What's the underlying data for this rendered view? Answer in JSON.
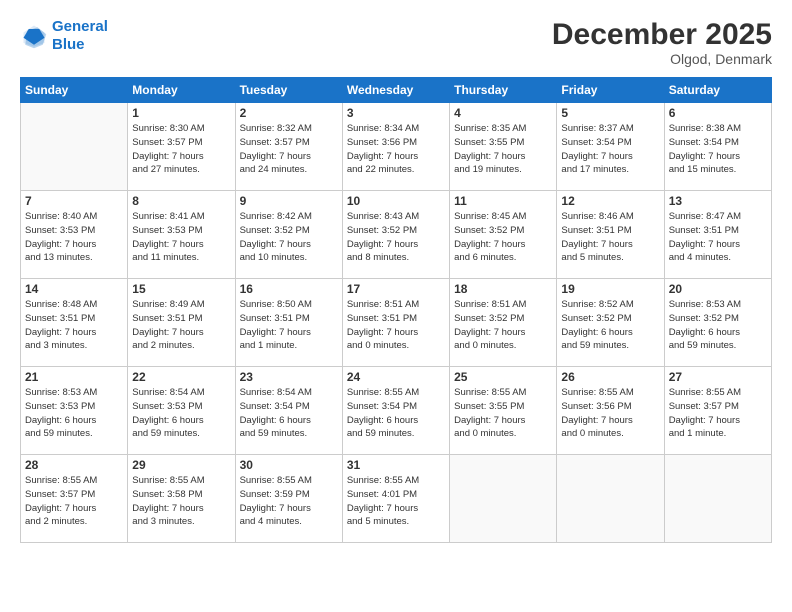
{
  "header": {
    "logo_line1": "General",
    "logo_line2": "Blue",
    "month": "December 2025",
    "location": "Olgod, Denmark"
  },
  "days_of_week": [
    "Sunday",
    "Monday",
    "Tuesday",
    "Wednesday",
    "Thursday",
    "Friday",
    "Saturday"
  ],
  "weeks": [
    [
      {
        "num": "",
        "info": ""
      },
      {
        "num": "1",
        "info": "Sunrise: 8:30 AM\nSunset: 3:57 PM\nDaylight: 7 hours\nand 27 minutes."
      },
      {
        "num": "2",
        "info": "Sunrise: 8:32 AM\nSunset: 3:57 PM\nDaylight: 7 hours\nand 24 minutes."
      },
      {
        "num": "3",
        "info": "Sunrise: 8:34 AM\nSunset: 3:56 PM\nDaylight: 7 hours\nand 22 minutes."
      },
      {
        "num": "4",
        "info": "Sunrise: 8:35 AM\nSunset: 3:55 PM\nDaylight: 7 hours\nand 19 minutes."
      },
      {
        "num": "5",
        "info": "Sunrise: 8:37 AM\nSunset: 3:54 PM\nDaylight: 7 hours\nand 17 minutes."
      },
      {
        "num": "6",
        "info": "Sunrise: 8:38 AM\nSunset: 3:54 PM\nDaylight: 7 hours\nand 15 minutes."
      }
    ],
    [
      {
        "num": "7",
        "info": "Sunrise: 8:40 AM\nSunset: 3:53 PM\nDaylight: 7 hours\nand 13 minutes."
      },
      {
        "num": "8",
        "info": "Sunrise: 8:41 AM\nSunset: 3:53 PM\nDaylight: 7 hours\nand 11 minutes."
      },
      {
        "num": "9",
        "info": "Sunrise: 8:42 AM\nSunset: 3:52 PM\nDaylight: 7 hours\nand 10 minutes."
      },
      {
        "num": "10",
        "info": "Sunrise: 8:43 AM\nSunset: 3:52 PM\nDaylight: 7 hours\nand 8 minutes."
      },
      {
        "num": "11",
        "info": "Sunrise: 8:45 AM\nSunset: 3:52 PM\nDaylight: 7 hours\nand 6 minutes."
      },
      {
        "num": "12",
        "info": "Sunrise: 8:46 AM\nSunset: 3:51 PM\nDaylight: 7 hours\nand 5 minutes."
      },
      {
        "num": "13",
        "info": "Sunrise: 8:47 AM\nSunset: 3:51 PM\nDaylight: 7 hours\nand 4 minutes."
      }
    ],
    [
      {
        "num": "14",
        "info": "Sunrise: 8:48 AM\nSunset: 3:51 PM\nDaylight: 7 hours\nand 3 minutes."
      },
      {
        "num": "15",
        "info": "Sunrise: 8:49 AM\nSunset: 3:51 PM\nDaylight: 7 hours\nand 2 minutes."
      },
      {
        "num": "16",
        "info": "Sunrise: 8:50 AM\nSunset: 3:51 PM\nDaylight: 7 hours\nand 1 minute."
      },
      {
        "num": "17",
        "info": "Sunrise: 8:51 AM\nSunset: 3:51 PM\nDaylight: 7 hours\nand 0 minutes."
      },
      {
        "num": "18",
        "info": "Sunrise: 8:51 AM\nSunset: 3:52 PM\nDaylight: 7 hours\nand 0 minutes."
      },
      {
        "num": "19",
        "info": "Sunrise: 8:52 AM\nSunset: 3:52 PM\nDaylight: 6 hours\nand 59 minutes."
      },
      {
        "num": "20",
        "info": "Sunrise: 8:53 AM\nSunset: 3:52 PM\nDaylight: 6 hours\nand 59 minutes."
      }
    ],
    [
      {
        "num": "21",
        "info": "Sunrise: 8:53 AM\nSunset: 3:53 PM\nDaylight: 6 hours\nand 59 minutes."
      },
      {
        "num": "22",
        "info": "Sunrise: 8:54 AM\nSunset: 3:53 PM\nDaylight: 6 hours\nand 59 minutes."
      },
      {
        "num": "23",
        "info": "Sunrise: 8:54 AM\nSunset: 3:54 PM\nDaylight: 6 hours\nand 59 minutes."
      },
      {
        "num": "24",
        "info": "Sunrise: 8:55 AM\nSunset: 3:54 PM\nDaylight: 6 hours\nand 59 minutes."
      },
      {
        "num": "25",
        "info": "Sunrise: 8:55 AM\nSunset: 3:55 PM\nDaylight: 7 hours\nand 0 minutes."
      },
      {
        "num": "26",
        "info": "Sunrise: 8:55 AM\nSunset: 3:56 PM\nDaylight: 7 hours\nand 0 minutes."
      },
      {
        "num": "27",
        "info": "Sunrise: 8:55 AM\nSunset: 3:57 PM\nDaylight: 7 hours\nand 1 minute."
      }
    ],
    [
      {
        "num": "28",
        "info": "Sunrise: 8:55 AM\nSunset: 3:57 PM\nDaylight: 7 hours\nand 2 minutes."
      },
      {
        "num": "29",
        "info": "Sunrise: 8:55 AM\nSunset: 3:58 PM\nDaylight: 7 hours\nand 3 minutes."
      },
      {
        "num": "30",
        "info": "Sunrise: 8:55 AM\nSunset: 3:59 PM\nDaylight: 7 hours\nand 4 minutes."
      },
      {
        "num": "31",
        "info": "Sunrise: 8:55 AM\nSunset: 4:01 PM\nDaylight: 7 hours\nand 5 minutes."
      },
      {
        "num": "",
        "info": ""
      },
      {
        "num": "",
        "info": ""
      },
      {
        "num": "",
        "info": ""
      }
    ]
  ]
}
